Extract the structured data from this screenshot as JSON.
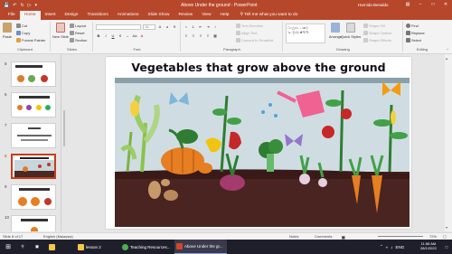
{
  "titlebar": {
    "title": "Above Under the ground  -  PowerPoint",
    "user": "Harnida Benaldo",
    "quick_access": [
      "save",
      "undo",
      "redo",
      "present",
      "more"
    ],
    "window_controls": [
      "ribbon-display",
      "minimize",
      "restore",
      "close"
    ]
  },
  "tabs": [
    "File",
    "Home",
    "Insert",
    "Design",
    "Transitions",
    "Animations",
    "Slide Show",
    "Review",
    "View",
    "Help"
  ],
  "tell_me": "Tell me what you want to do",
  "ribbon": {
    "clipboard": {
      "label": "Clipboard",
      "paste": "Paste",
      "cut": "Cut",
      "copy": "Copy",
      "format_painter": "Format Painter"
    },
    "slides": {
      "label": "Slides",
      "new_slide": "New Slide",
      "layout": "Layout",
      "reset": "Reset",
      "section": "Section"
    },
    "font": {
      "label": "Font",
      "size": "18"
    },
    "paragraph": {
      "label": "Paragraph",
      "text_direction": "Text Direction",
      "align_text": "Align Text",
      "convert_smartart": "Convert to SmartArt"
    },
    "drawing": {
      "label": "Drawing",
      "arrange": "Arrange",
      "quick_styles": "Quick Styles",
      "shape_fill": "Shape Fill",
      "shape_outline": "Shape Outline",
      "shape_effects": "Shape Effects"
    },
    "editing": {
      "label": "Editing",
      "find": "Find",
      "replace": "Replace",
      "select": "Select"
    }
  },
  "thumbnails": [
    {
      "num": "5"
    },
    {
      "num": "6"
    },
    {
      "num": "7"
    },
    {
      "num": "8",
      "selected": true
    },
    {
      "num": "9"
    },
    {
      "num": "10"
    }
  ],
  "slide": {
    "title": "Vegetables that grow above the ground"
  },
  "statusbar": {
    "slide_of": "Slide 8 of 17",
    "language": "English (Malaysia)",
    "notes": "Notes",
    "comments": "Comments",
    "zoom": "72%"
  },
  "taskbar": {
    "apps": [
      {
        "label": "lesson 2",
        "color": "#f2c84b"
      },
      {
        "label": "Teaching Resources...",
        "color": "#4caf50"
      },
      {
        "label": "Above Under the gr...",
        "color": "#d24726",
        "active": true
      }
    ],
    "language": "ENG",
    "time": "11:58 AM",
    "date": "28/1/2022"
  },
  "colors": {
    "accent": "#b7472a",
    "selected_thumb": "#c43e1c"
  }
}
